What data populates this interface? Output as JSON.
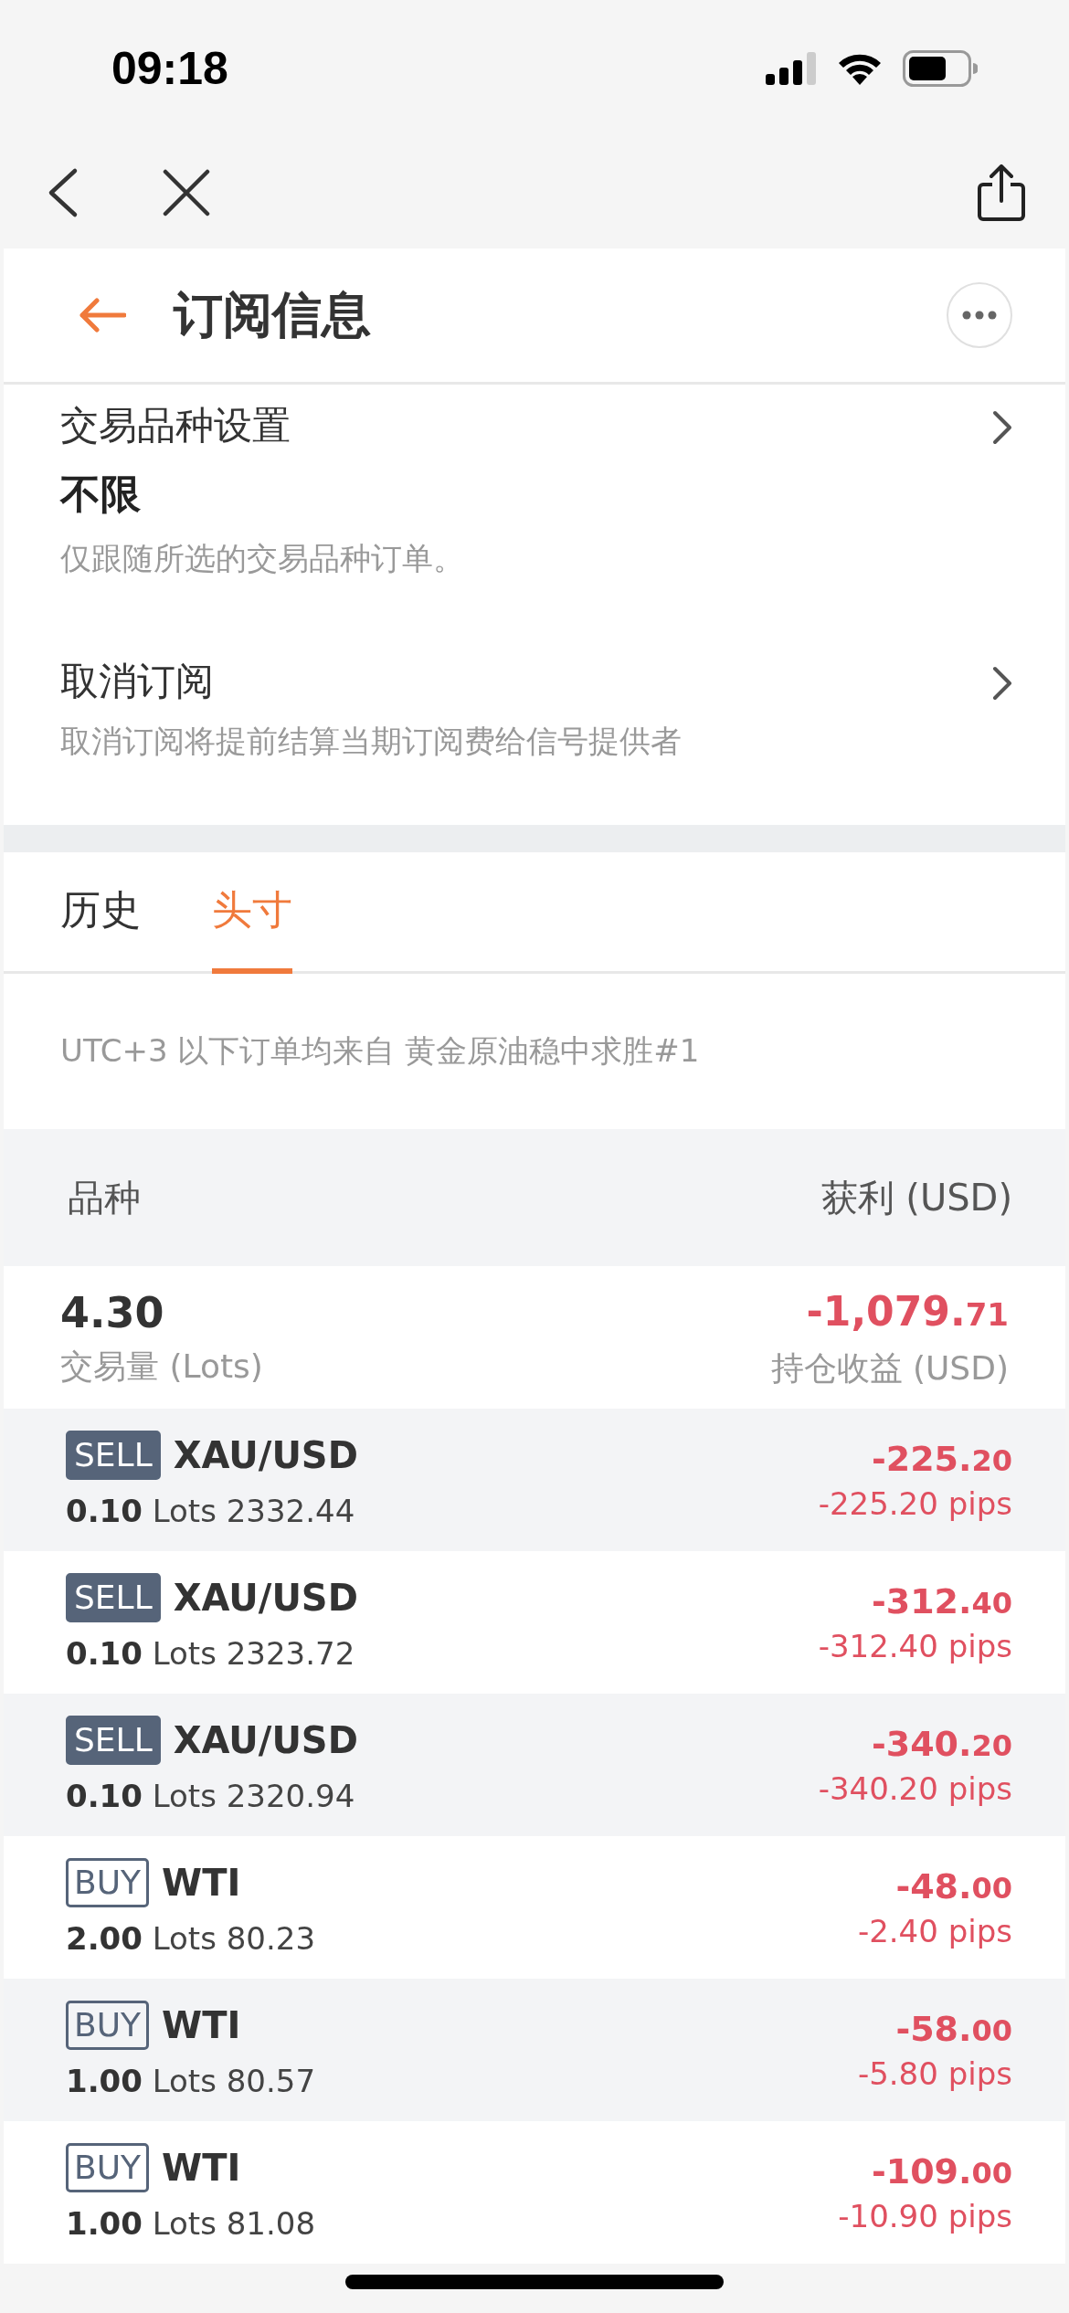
{
  "status_bar": {
    "time": "09:18"
  },
  "header": {
    "title": "订阅信息"
  },
  "settings": [
    {
      "title": "交易品种设置",
      "value": "不限",
      "hint": "仅跟随所选的交易品种订单。"
    },
    {
      "title": "取消订阅",
      "hint": "取消订阅将提前结算当期订阅费给信号提供者"
    }
  ],
  "tabs": [
    {
      "label": "历史",
      "selected": false
    },
    {
      "label": "头寸",
      "selected": true
    }
  ],
  "info": "UTC+3 以下订单均来自 黄金原油稳中求胜#1",
  "table": {
    "columns": [
      "品种",
      "获利 (USD)"
    ],
    "summary": {
      "volume": "4.30",
      "volume_label": "交易量 (Lots)",
      "profit_whole": "-1,079.",
      "profit_fraction": "71",
      "profit_label": "持仓收益 (USD)"
    },
    "rows": [
      {
        "kind": "sell",
        "side": "SELL",
        "symbol": "XAU/USD",
        "lots": "0.10",
        "unit": "Lots",
        "price": "2332.44",
        "profit_whole": "-225.",
        "profit_fraction": "20",
        "pips": "-225.20 pips"
      },
      {
        "kind": "sell",
        "side": "SELL",
        "symbol": "XAU/USD",
        "lots": "0.10",
        "unit": "Lots",
        "price": "2323.72",
        "profit_whole": "-312.",
        "profit_fraction": "40",
        "pips": "-312.40 pips"
      },
      {
        "kind": "sell",
        "side": "SELL",
        "symbol": "XAU/USD",
        "lots": "0.10",
        "unit": "Lots",
        "price": "2320.94",
        "profit_whole": "-340.",
        "profit_fraction": "20",
        "pips": "-340.20 pips"
      },
      {
        "kind": "buy",
        "side": "BUY",
        "symbol": "WTI",
        "lots": "2.00",
        "unit": "Lots",
        "price": "80.23",
        "profit_whole": "-48.",
        "profit_fraction": "00",
        "pips": "-2.40 pips"
      },
      {
        "kind": "buy",
        "side": "BUY",
        "symbol": "WTI",
        "lots": "1.00",
        "unit": "Lots",
        "price": "80.57",
        "profit_whole": "-58.",
        "profit_fraction": "00",
        "pips": "-5.80 pips"
      },
      {
        "kind": "buy",
        "side": "BUY",
        "symbol": "WTI",
        "lots": "1.00",
        "unit": "Lots",
        "price": "81.08",
        "profit_whole": "-109.",
        "profit_fraction": "00",
        "pips": "-10.90 pips"
      }
    ]
  }
}
